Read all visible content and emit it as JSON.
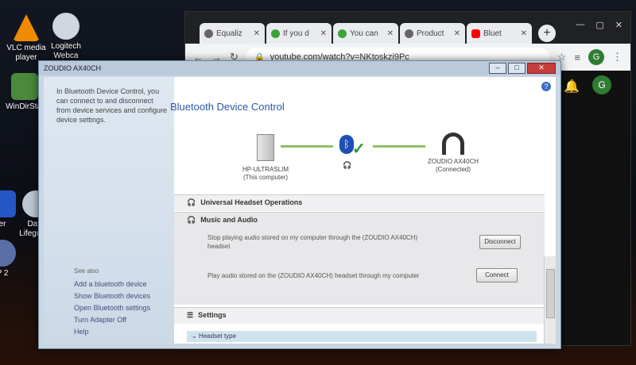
{
  "desktop": {
    "icons": [
      {
        "label": "VLC media player",
        "icon": "vlc-icon",
        "color": "#f08a00"
      },
      {
        "label": "Logitech Webca",
        "icon": "webcam-icon",
        "color": "#cfd6de"
      },
      {
        "label": "WinDirStat",
        "icon": "windirstat-icon",
        "color": "#4a8a3a"
      },
      {
        "label": "Data Lifeguard",
        "icon": "lifeguard-icon",
        "color": "#bfc7d2"
      },
      {
        "label": "er",
        "icon": "app-icon",
        "color": "#2457c5"
      },
      {
        "label": "P 2",
        "icon": "app-icon",
        "color": "#5a6ea8"
      }
    ]
  },
  "browser": {
    "tabs": [
      {
        "title": "Equaliz",
        "icon": "globe-icon",
        "color": "#666"
      },
      {
        "title": "If you d",
        "icon": "wikihow-icon",
        "color": "#3aa33a"
      },
      {
        "title": "You can",
        "icon": "wikihow-icon",
        "color": "#3aa33a"
      },
      {
        "title": "Product",
        "icon": "shop-icon",
        "color": "#666"
      },
      {
        "title": "Bluet",
        "icon": "youtube-icon",
        "color": "#ff0000"
      }
    ],
    "new_tab": "+",
    "url": "youtube.com/watch?v=NKtoskzi9Pc",
    "avatar_letter": "G",
    "page_avatar_letter": "G"
  },
  "dialog": {
    "title": "ZOUDIO AX40CH",
    "intro_text": "In Bluetooth Device Control, you can connect to and disconnect from device services and configure device settings.",
    "see_also": "See also",
    "links": [
      "Add a bluetooth device",
      "Show Bluetooth devices",
      "Open Bluetooth settings",
      "Turn Adapter Off",
      "Help"
    ],
    "main_title": "Bluetooth Device Control",
    "computer": {
      "name": "HP-ULTRASLIM",
      "sub": "(This computer)"
    },
    "headset": {
      "name": "ZOUDIO AX40CH",
      "sub": "(Connected)"
    },
    "sections": {
      "universal": "Universal Headset Operations",
      "music": "Music and Audio",
      "settings": "Settings",
      "headset_type": "Headset type"
    },
    "rows": [
      {
        "text": "Stop playing audio stored on my computer through the (ZOUDIO AX40CH) headset",
        "button": "Disconnect"
      },
      {
        "text": "Play audio stored on the (ZOUDIO AX40CH) headset through my computer",
        "button": "Connect"
      }
    ],
    "help_icon": "?"
  }
}
